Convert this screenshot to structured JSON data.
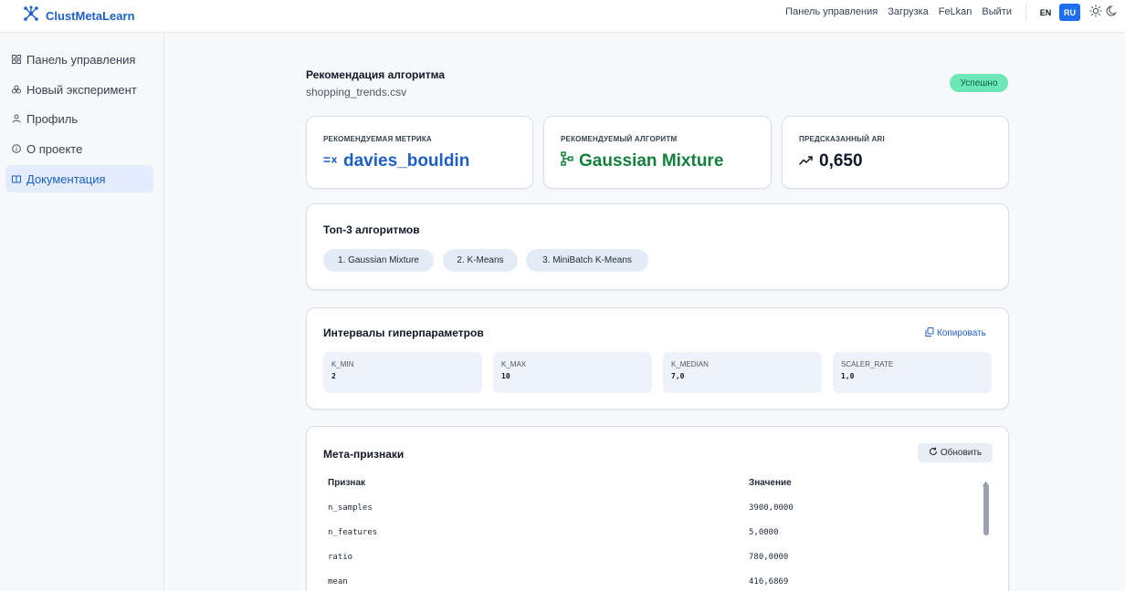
{
  "app": {
    "brand": "ClustMetaLearn"
  },
  "topnav": {
    "items": [
      "Панель управления",
      "Загрузка",
      "FeLkan",
      "Выйти"
    ],
    "lang_en": "EN",
    "lang_ru": "RU",
    "active_lang": "RU"
  },
  "sidebar": {
    "items": [
      {
        "label": "Панель управления",
        "icon": "dashboard-icon"
      },
      {
        "label": "Новый эксперимент",
        "icon": "experiment-icon"
      },
      {
        "label": "Профиль",
        "icon": "user-icon"
      },
      {
        "label": "О проекте",
        "icon": "info-icon"
      },
      {
        "label": "Документация",
        "icon": "book-icon"
      }
    ],
    "active": "Документация"
  },
  "page": {
    "title": "Рекомендация алгоритма",
    "subtitle": "shopping_trends.csv",
    "status": "Успешно"
  },
  "cards": {
    "metric": {
      "label": "РЕКОМЕНДУЕМАЯ МЕТРИКА",
      "value": "davies_bouldin",
      "color": "#1d5fc9"
    },
    "algorithm": {
      "label": "РЕКОМЕНДУЕМЫЙ АЛГОРИТМ",
      "value": "Gaussian Mixture",
      "color": "#15803d"
    },
    "ari": {
      "label": "ПРЕДСКАЗАННЫЙ ARI",
      "value": "0,650",
      "color": "#111827"
    }
  },
  "top3": {
    "title": "Топ-3 алгоритмов",
    "items": [
      "1. Gaussian Mixture",
      "2. K-Means",
      "3. MiniBatch K-Means"
    ]
  },
  "hyperparams": {
    "title": "Интервалы гиперпараметров",
    "copy_label": "Копировать",
    "items": [
      {
        "name": "K_MIN",
        "value": "2"
      },
      {
        "name": "K_MAX",
        "value": "10"
      },
      {
        "name": "K_MEDIAN",
        "value": "7,0"
      },
      {
        "name": "SCALER_RATE",
        "value": "1,0"
      }
    ]
  },
  "meta": {
    "title": "Мета-признаки",
    "refresh_label": "Обновить",
    "columns": [
      "Признак",
      "Значение"
    ],
    "rows": [
      [
        "n_samples",
        "3900,0000"
      ],
      [
        "n_features",
        "5,0000"
      ],
      [
        "ratio",
        "780,0000"
      ],
      [
        "mean",
        "416,6869"
      ]
    ]
  }
}
